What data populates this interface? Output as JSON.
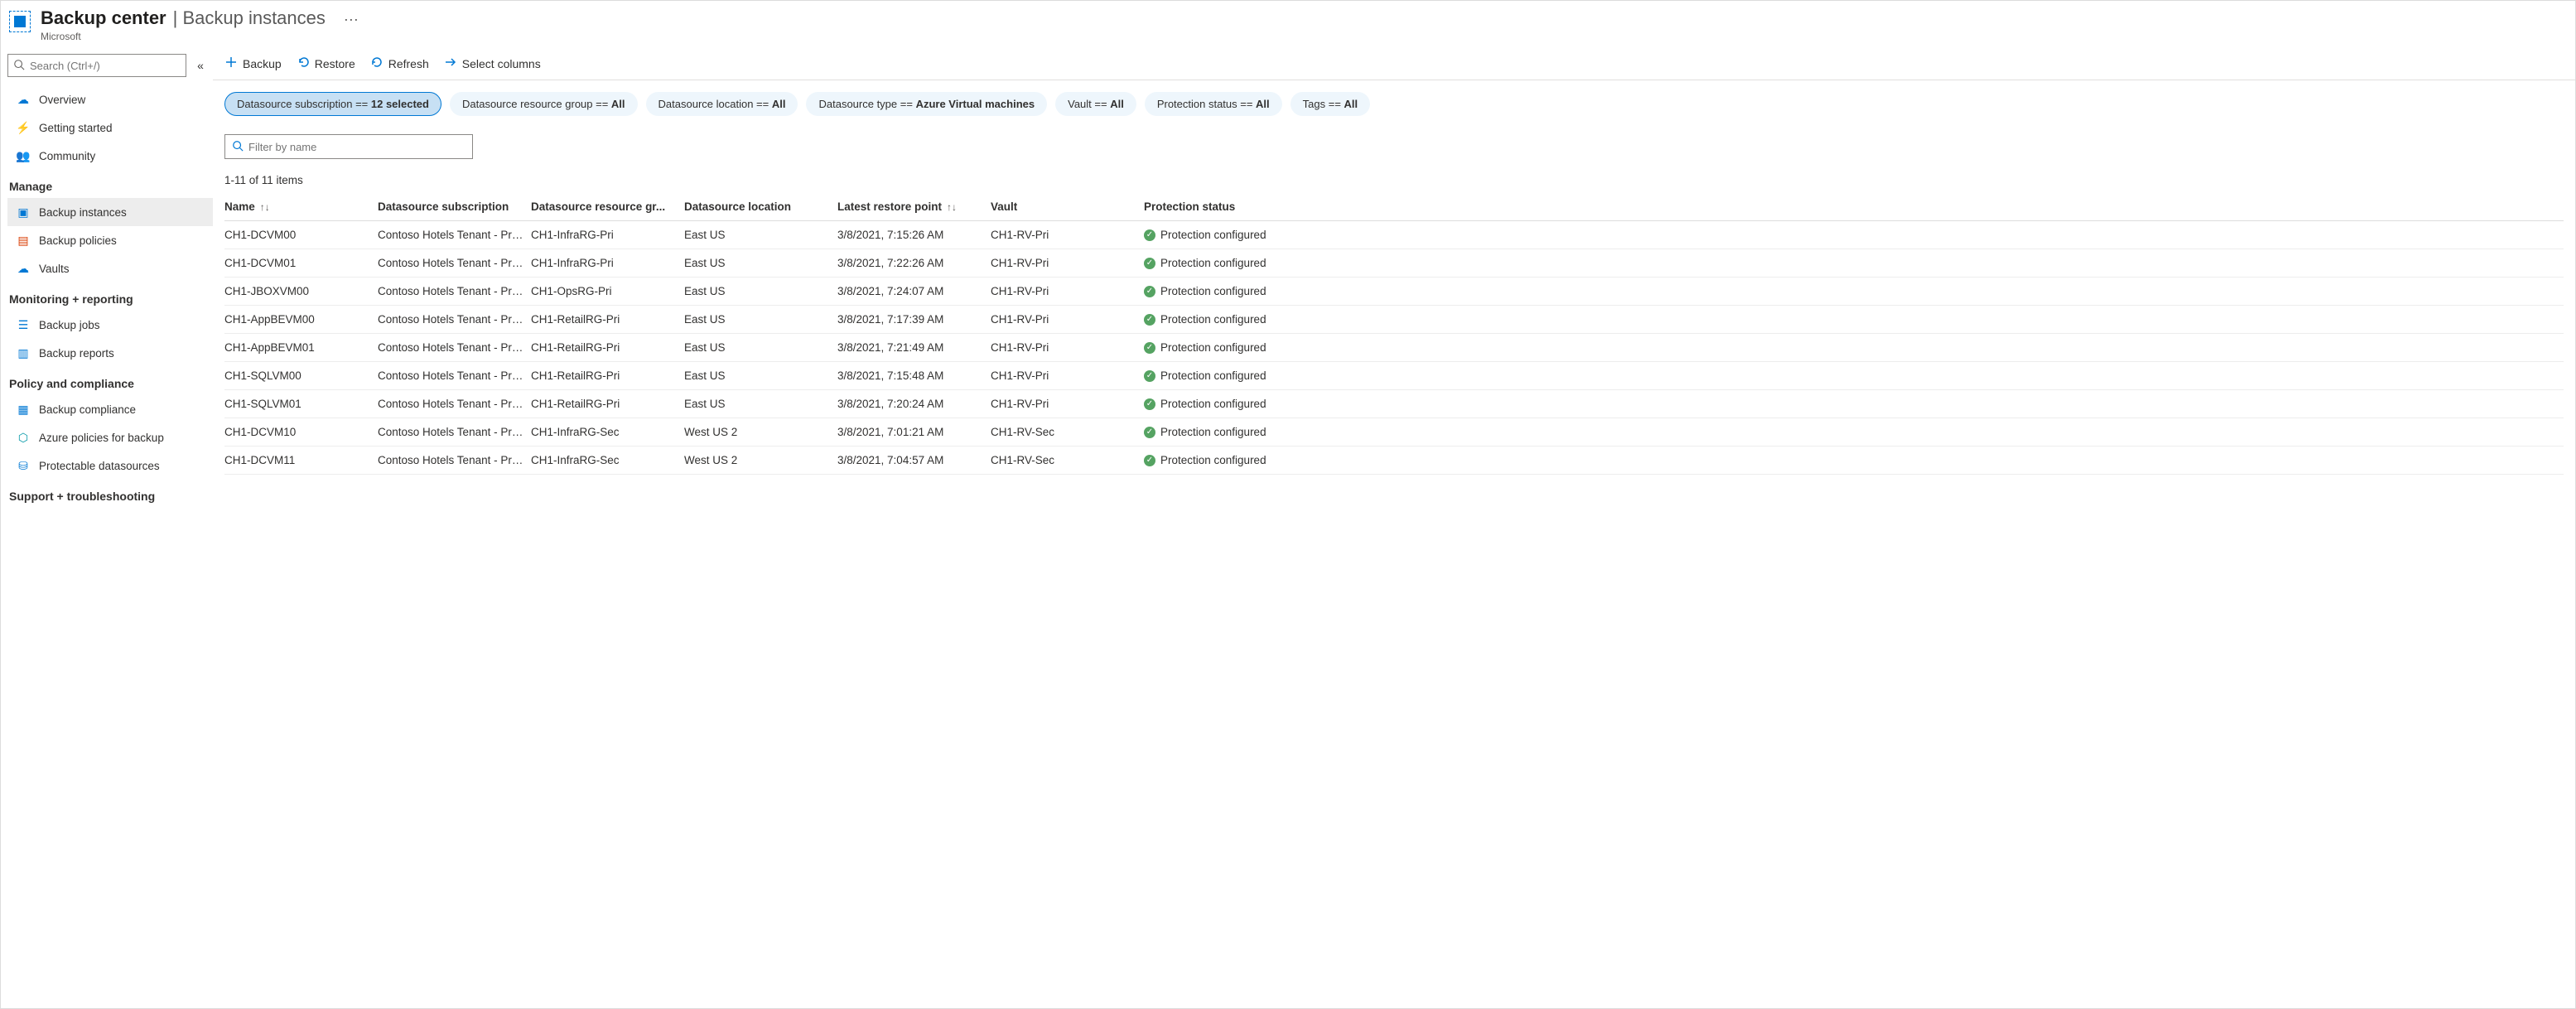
{
  "header": {
    "title": "Backup center",
    "subtitle": "Backup instances",
    "org": "Microsoft"
  },
  "sidebar": {
    "search_placeholder": "Search (Ctrl+/)",
    "top": [
      {
        "icon": "overview",
        "label": "Overview"
      },
      {
        "icon": "getting-started",
        "label": "Getting started"
      },
      {
        "icon": "community",
        "label": "Community"
      }
    ],
    "sections": [
      {
        "title": "Manage",
        "items": [
          {
            "icon": "backup-instances",
            "label": "Backup instances",
            "active": true
          },
          {
            "icon": "backup-policies",
            "label": "Backup policies"
          },
          {
            "icon": "vaults",
            "label": "Vaults"
          }
        ]
      },
      {
        "title": "Monitoring + reporting",
        "items": [
          {
            "icon": "backup-jobs",
            "label": "Backup jobs"
          },
          {
            "icon": "backup-reports",
            "label": "Backup reports"
          }
        ]
      },
      {
        "title": "Policy and compliance",
        "items": [
          {
            "icon": "backup-compliance",
            "label": "Backup compliance"
          },
          {
            "icon": "azure-policies",
            "label": "Azure policies for backup"
          },
          {
            "icon": "protectable",
            "label": "Protectable datasources"
          }
        ]
      },
      {
        "title": "Support + troubleshooting",
        "items": []
      }
    ]
  },
  "toolbar": [
    {
      "icon": "plus",
      "label": "Backup"
    },
    {
      "icon": "undo",
      "label": "Restore"
    },
    {
      "icon": "refresh",
      "label": "Refresh"
    },
    {
      "icon": "arrow",
      "label": "Select columns"
    }
  ],
  "filters": [
    {
      "label": "Datasource subscription == ",
      "value": "12 selected",
      "selected": true
    },
    {
      "label": "Datasource resource group == ",
      "value": "All"
    },
    {
      "label": "Datasource location == ",
      "value": "All"
    },
    {
      "label": "Datasource type == ",
      "value": "Azure Virtual machines"
    },
    {
      "label": "Vault == ",
      "value": "All"
    },
    {
      "label": "Protection status == ",
      "value": "All"
    },
    {
      "label": "Tags == ",
      "value": "All"
    }
  ],
  "filter_by_name_placeholder": "Filter by name",
  "count_text": "1-11 of 11 items",
  "columns": {
    "name": "Name",
    "sub": "Datasource subscription",
    "rg": "Datasource resource gr...",
    "loc": "Datasource location",
    "rp": "Latest restore point",
    "vault": "Vault",
    "status": "Protection status"
  },
  "rows": [
    {
      "name": "CH1-DCVM00",
      "sub": "Contoso Hotels Tenant - Pro...",
      "rg": "CH1-InfraRG-Pri",
      "loc": "East US",
      "rp": "3/8/2021, 7:15:26 AM",
      "vault": "CH1-RV-Pri",
      "status": "Protection configured"
    },
    {
      "name": "CH1-DCVM01",
      "sub": "Contoso Hotels Tenant - Pro...",
      "rg": "CH1-InfraRG-Pri",
      "loc": "East US",
      "rp": "3/8/2021, 7:22:26 AM",
      "vault": "CH1-RV-Pri",
      "status": "Protection configured"
    },
    {
      "name": "CH1-JBOXVM00",
      "sub": "Contoso Hotels Tenant - Pro...",
      "rg": "CH1-OpsRG-Pri",
      "loc": "East US",
      "rp": "3/8/2021, 7:24:07 AM",
      "vault": "CH1-RV-Pri",
      "status": "Protection configured"
    },
    {
      "name": "CH1-AppBEVM00",
      "sub": "Contoso Hotels Tenant - Pro...",
      "rg": "CH1-RetailRG-Pri",
      "loc": "East US",
      "rp": "3/8/2021, 7:17:39 AM",
      "vault": "CH1-RV-Pri",
      "status": "Protection configured"
    },
    {
      "name": "CH1-AppBEVM01",
      "sub": "Contoso Hotels Tenant - Pro...",
      "rg": "CH1-RetailRG-Pri",
      "loc": "East US",
      "rp": "3/8/2021, 7:21:49 AM",
      "vault": "CH1-RV-Pri",
      "status": "Protection configured"
    },
    {
      "name": "CH1-SQLVM00",
      "sub": "Contoso Hotels Tenant - Pro...",
      "rg": "CH1-RetailRG-Pri",
      "loc": "East US",
      "rp": "3/8/2021, 7:15:48 AM",
      "vault": "CH1-RV-Pri",
      "status": "Protection configured"
    },
    {
      "name": "CH1-SQLVM01",
      "sub": "Contoso Hotels Tenant - Pro...",
      "rg": "CH1-RetailRG-Pri",
      "loc": "East US",
      "rp": "3/8/2021, 7:20:24 AM",
      "vault": "CH1-RV-Pri",
      "status": "Protection configured"
    },
    {
      "name": "CH1-DCVM10",
      "sub": "Contoso Hotels Tenant - Pro...",
      "rg": "CH1-InfraRG-Sec",
      "loc": "West US 2",
      "rp": "3/8/2021, 7:01:21 AM",
      "vault": "CH1-RV-Sec",
      "status": "Protection configured"
    },
    {
      "name": "CH1-DCVM11",
      "sub": "Contoso Hotels Tenant - Pro...",
      "rg": "CH1-InfraRG-Sec",
      "loc": "West US 2",
      "rp": "3/8/2021, 7:04:57 AM",
      "vault": "CH1-RV-Sec",
      "status": "Protection configured"
    }
  ]
}
